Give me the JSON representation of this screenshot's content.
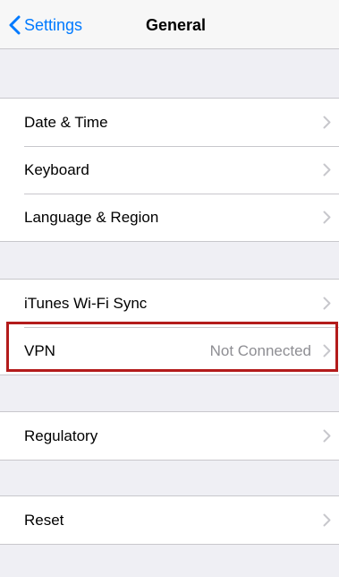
{
  "nav": {
    "back_label": "Settings",
    "title": "General",
    "back_icon": "chevron-left-icon"
  },
  "groups": [
    {
      "rows": [
        {
          "label": "Date & Time"
        },
        {
          "label": "Keyboard"
        },
        {
          "label": "Language & Region"
        }
      ]
    },
    {
      "rows": [
        {
          "label": "iTunes Wi-Fi Sync"
        },
        {
          "label": "VPN",
          "detail": "Not Connected",
          "highlighted": true
        }
      ]
    },
    {
      "rows": [
        {
          "label": "Regulatory"
        }
      ]
    },
    {
      "rows": [
        {
          "label": "Reset"
        }
      ]
    }
  ],
  "colors": {
    "accent": "#007aff",
    "background": "#efeff4",
    "detail_text": "#8e8e93",
    "highlight_border": "#b31b1b"
  }
}
